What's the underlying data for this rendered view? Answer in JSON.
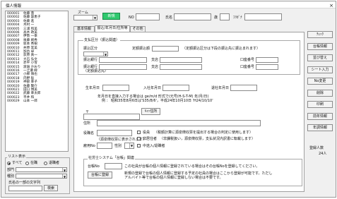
{
  "window": {
    "title": "個人情報",
    "close": "×"
  },
  "person_list": [
    {
      "id": "000001",
      "name": "佐藤 蓋"
    },
    {
      "id": "000002",
      "name": "佐藤 容恵子"
    },
    {
      "id": "000003",
      "name": "佐藤 進"
    },
    {
      "id": "000004",
      "name": "木村 一"
    },
    {
      "id": "000005",
      "name": "三浦 和美"
    },
    {
      "id": "000006",
      "name": "高木 政美"
    },
    {
      "id": "000007",
      "name": "伊勢 一幸"
    },
    {
      "id": "000008",
      "name": "後藤 純秀"
    },
    {
      "id": "000009",
      "name": "坂本 秀樹"
    },
    {
      "id": "000010",
      "name": "井原 実美"
    },
    {
      "id": "000011",
      "name": "加古 卓"
    },
    {
      "id": "000012",
      "name": "荻原 真一"
    },
    {
      "id": "000013",
      "name": "大石 弘文"
    },
    {
      "id": "000014",
      "name": "赤平 小雪"
    },
    {
      "id": "000015",
      "name": "渡邉 かおり"
    },
    {
      "id": "000016",
      "name": "一之瀬 緑"
    },
    {
      "id": "000017",
      "name": "小柳 慎也"
    },
    {
      "id": "000018",
      "name": "内野 猛"
    },
    {
      "id": "000019",
      "name": "神部 幸子"
    },
    {
      "id": "000020",
      "name": "佐藤 賢介"
    },
    {
      "id": "000021",
      "name": "田口 博美"
    },
    {
      "id": "000022",
      "name": "武藤 幸太郎"
    },
    {
      "id": "000023",
      "name": "平井 和"
    },
    {
      "id": "000029",
      "name": "山本 一郎"
    }
  ],
  "list_display": {
    "legend": "リスト表示",
    "options": [
      "すべて",
      "在職",
      "退職者"
    ],
    "selected_index": 0,
    "dept_label": "部門",
    "type_label": "種別",
    "search_label": "氏名の一部の文字列",
    "search_button": "検索",
    "search_value": ""
  },
  "header": {
    "zoom_label": "ズーム",
    "zoom_value": "",
    "new_button": "新規",
    "no_label": "NO",
    "no_value": "",
    "name_label": "氏名",
    "name_value": "",
    "age_label": "歳",
    "kana_label": "ﾌﾘｶﾞﾅ",
    "kana_value": ""
  },
  "tabs": [
    "基本情報",
    "振込/年月日/住所等",
    "その他"
  ],
  "active_tab": 1,
  "payment": {
    "legend": "支払区分（振込関連）",
    "type_label": "振込区分",
    "fixed_amount_label": "定額振込額",
    "fixed_note": "（定額振込区分は下段の振込先に振込まれます）",
    "bank1_label": "振込銀行",
    "branch_label": "支店",
    "account_label": "口座番号",
    "bank2_label": "振込銀行",
    "bank2_sub": "（定額振込先）"
  },
  "dates": {
    "birth_label": "生年月日",
    "hire_label": "入社年月日",
    "retire_label": "退社年月日",
    "note1": "年月日を直接入力する場合は ge/m/d 形式で(元号(H-S-T-M) 年/月/日)",
    "note2": "例 ： 昭和35年8月6日は'S35/8/6'，平成24年10月10日 'H24/10/10'"
  },
  "address": {
    "zip_symbol": "〒",
    "zip_button": "ｷｬｯ住所",
    "addr_label": "住所",
    "title_label": "役職名",
    "officer_label": "役員",
    "officer_note": "（税額計算に源泉徴収票を提出する場合の判定に使用します）",
    "tax_note": "（源泉徴収票に表示されます）",
    "nonresident_label": "非居住者",
    "nonresident_note": "（非課税扱い，源泉徴収票，支払状況内訳書に転載します）",
    "employment_label": "雇用No",
    "gender_label": "性別",
    "midyear_label": "中途入/退職者"
  },
  "mynumber": {
    "legend": "社労士システム「台帳」関連",
    "ledger_label": "台帳No",
    "ledger_button": "台帳に登録",
    "note1": "この社員が台帳の個人情報に登録されている場合はその台帳Noを登録してください。",
    "note2": "新規の登録で台帳の個人情報に登録する予定の社員の場合はここから登録が可能です。ただし",
    "note3": "アルバイト等で台帳の個人情報に登録しない場合は不要です。"
  },
  "right_buttons": [
    "ﾁｪｯｸ",
    "台帳情報",
    "並び替え",
    "シート入力",
    "No変更",
    "削除",
    "印刷",
    "前年情報",
    "年調情報"
  ],
  "count": {
    "label": "登録人数",
    "value": "24人"
  }
}
